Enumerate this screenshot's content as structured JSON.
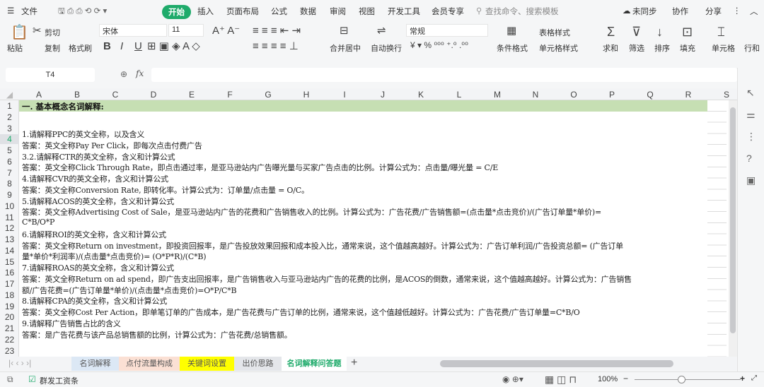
{
  "menu": {
    "file": "文件",
    "tabs": [
      "开始",
      "插入",
      "页面布局",
      "公式",
      "数据",
      "审阅",
      "视图",
      "开发工具",
      "会员专享"
    ],
    "search": "查找命令、搜索模板",
    "sync": "未同步",
    "collab": "协作",
    "share": "分享"
  },
  "ribbon": {
    "paste": "粘贴",
    "cut": "剪切",
    "copy": "复制",
    "format_painter": "格式刷",
    "font": "宋体",
    "font_size": "11",
    "merge": "合并居中",
    "wrap": "自动换行",
    "number_format": "常规",
    "cond_format": "条件格式",
    "table_style": "表格样式",
    "cell_style": "单元格样式",
    "sum": "求和",
    "filter": "筛选",
    "sort": "排序",
    "fill": "填充",
    "cell": "单元格",
    "rowcol": "行和"
  },
  "formula": {
    "cell_ref": "T4",
    "fx": "fx",
    "value": ""
  },
  "columns": [
    "A",
    "B",
    "C",
    "D",
    "E",
    "F",
    "G",
    "H",
    "I",
    "J",
    "K",
    "L",
    "M",
    "N",
    "O",
    "P",
    "Q",
    "R",
    "S"
  ],
  "rows": [
    "1",
    "2",
    "3",
    "4",
    "5",
    "6",
    "7",
    "8",
    "9",
    "10",
    "11",
    "12",
    "13",
    "14",
    "15",
    "16",
    "17",
    "18",
    "19",
    "20",
    "21",
    "22",
    "23"
  ],
  "title": "一. 基本概念名词解释:",
  "lines": [
    "1.请解释PPC的英文全称，以及含义",
    "答案：英文全称Pay Per Click，即每次点击付费广告",
    "3.2.请解释CTR的英文全称，含义和计算公式",
    "答案：英文全称Click Through Rate，即点击通过率，是亚马逊站内广告曝光量与买家广告点击的比例。计算公式为：点击量/曝光量 = C/E",
    "4.请解释CVR的英文全称，含义和计算公式",
    "答案：英文全称Conversion Rate, 即转化率。计算公式为：订单量/点击量 = O/C。",
    "5.请解释ACOS的英文全称，含义和计算公式",
    "答案：英文全称Advertising Cost of Sale，是亚马逊站内广告的花费和广告销售收入的比例。计算公式为：广告花费/广告销售额=(点击量*点击竞价)/(广告订单量*单价)=",
    "C*B/O*P",
    "6.请解释ROI的英文全称，含义和计算公式",
    "答案：英文全称Return on investment，即投资回报率，是广告投放效果回报和成本投入比，通常来说，这个值越高越好。计算公式为：广告订单利润/广告投资总额= (广告订单",
    "量*单价*利润率)/(点击量*点击竞价)= (O*P*R)/(C*B)",
    "7.请解释ROAS的英文全称，含义和计算公式",
    "答案：英文全称Return on ad spend，即广告支出回报率，是广告销售收入与亚马逊站内广告的花费的比例，是ACOS的倒数，通常来说，这个值越高越好。计算公式为：广告销售",
    "额/广告花费=(广告订单量*单价)/(点击量*点击竞价)=O*P/C*B",
    "8.请解释CPA的英文全称，含义和计算公式",
    "答案：英文全称Cost Per Action，即单笔订单的广告成本，是广告花费与广告订单的比例，通常来说，这个值越低越好。计算公式为：广告花费/广告订单量=C*B/O",
    "9.请解释广告销售占比的含义",
    "答案：是广告花费与该产品总销售额的比例，计算公式为：广告花费/总销售额。"
  ],
  "sheets": [
    {
      "label": "名词解释",
      "color": "#dce8f5"
    },
    {
      "label": "点付流量构成",
      "color": "#fbe0d4"
    },
    {
      "label": "关键词设置",
      "color": "#ffff00"
    },
    {
      "label": "出价思路",
      "color": "#e4e6ea"
    },
    {
      "label": "名词解释问答题",
      "color": "#ffffff"
    }
  ],
  "status": {
    "payroll": "群发工资条",
    "zoom": "100%"
  },
  "accent": "#1fab6b"
}
